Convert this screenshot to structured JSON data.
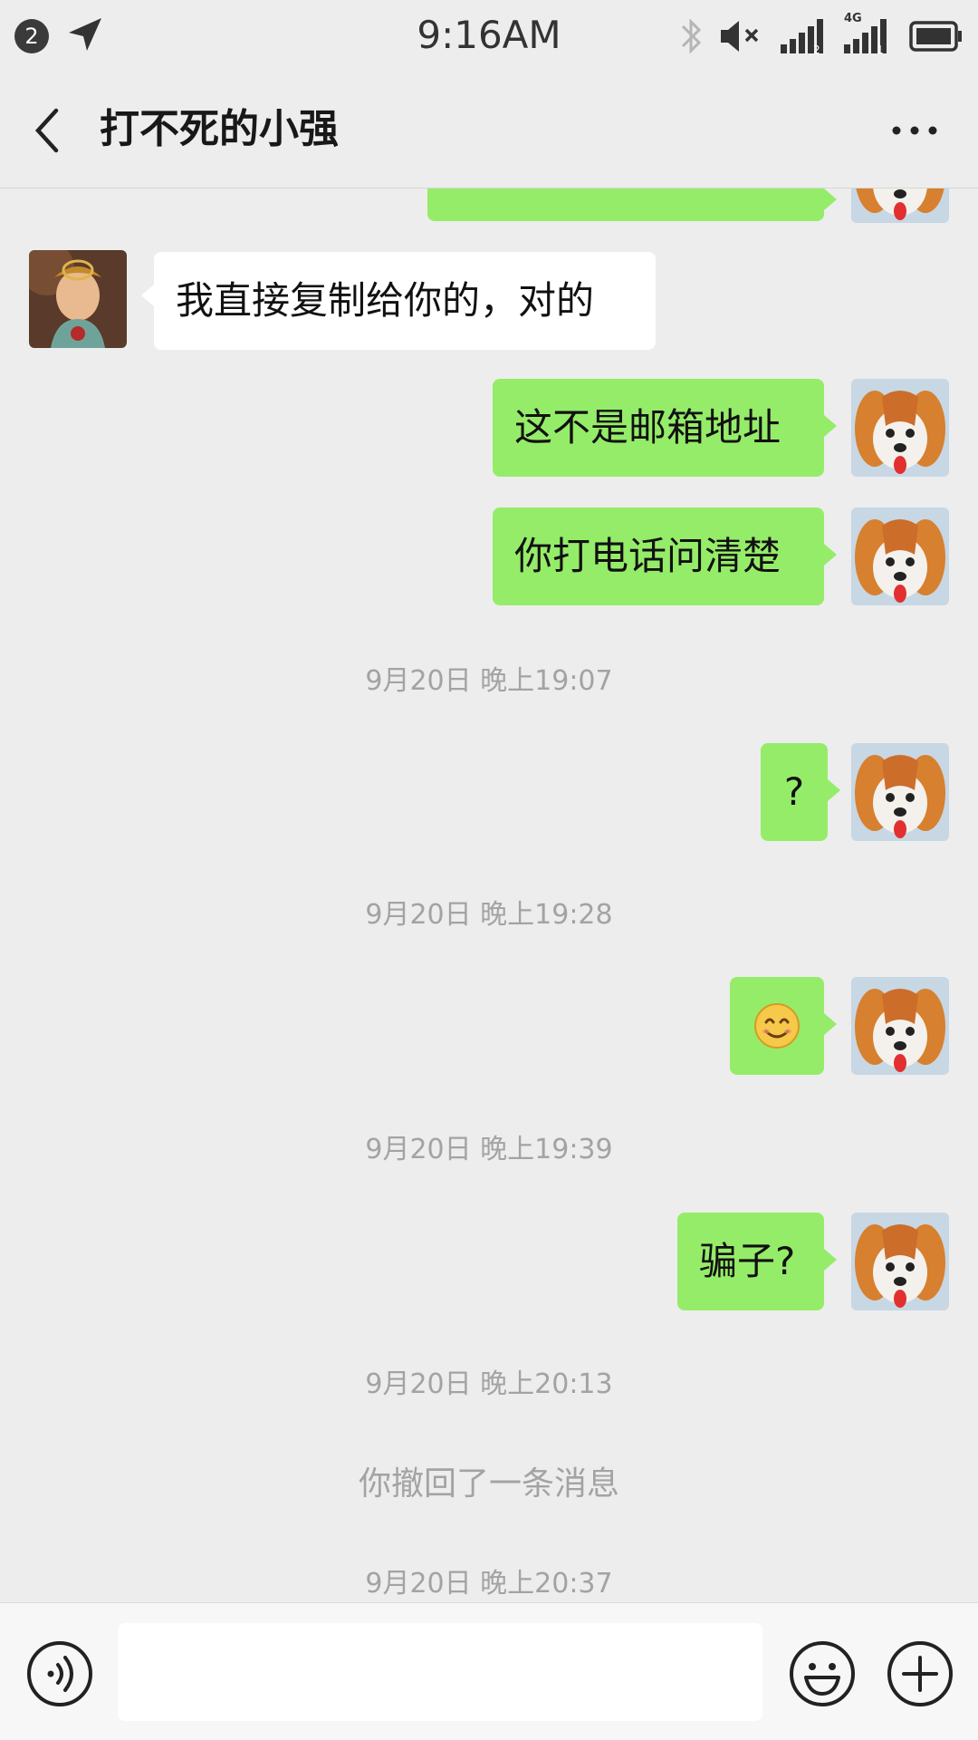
{
  "status_bar": {
    "notification_count": "2",
    "time": "9:16AM",
    "network_label": "4G",
    "icons": [
      "location-arrow-icon",
      "bluetooth-icon",
      "mute-icon",
      "signal-icon",
      "signal-4g-icon",
      "battery-icon"
    ]
  },
  "header": {
    "title": "打不死的小强",
    "back_icon": "chevron-left-icon",
    "more_icon": "more-dots-icon"
  },
  "messages": [
    {
      "sender": "me",
      "type": "text",
      "text": "",
      "partial": true
    },
    {
      "sender": "other",
      "type": "text",
      "text": "我直接复制给你的，对的"
    },
    {
      "sender": "me",
      "type": "text",
      "text": "这不是邮箱地址"
    },
    {
      "sender": "me",
      "type": "text",
      "text": "你打电话问清楚"
    },
    {
      "type": "timestamp",
      "text": "9月20日 晚上19:07"
    },
    {
      "sender": "me",
      "type": "text",
      "text": "?"
    },
    {
      "type": "timestamp",
      "text": "9月20日 晚上19:28"
    },
    {
      "sender": "me",
      "type": "emoji",
      "icon": "smile-emoji-icon"
    },
    {
      "type": "timestamp",
      "text": "9月20日 晚上19:39"
    },
    {
      "sender": "me",
      "type": "text",
      "text": "骗子?"
    },
    {
      "type": "timestamp",
      "text": "9月20日 晚上20:13"
    },
    {
      "type": "system",
      "text": "你撤回了一条消息"
    },
    {
      "type": "timestamp",
      "text": "9月20日 晚上20:37"
    }
  ],
  "input_bar": {
    "voice_icon": "voice-icon",
    "input_value": "",
    "emoji_icon": "emoji-face-icon",
    "plus_icon": "plus-icon"
  },
  "colors": {
    "background": "#ededed",
    "my_bubble": "#95ec69",
    "other_bubble": "#ffffff",
    "timestamp_text": "#a3a3a3"
  }
}
